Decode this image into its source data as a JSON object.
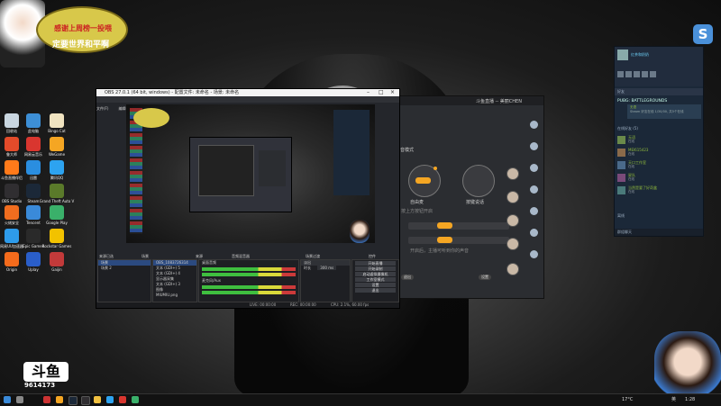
{
  "overlay": {
    "banner_line1": "感谢上周榜一投喂",
    "banner_line2": "定要世界和平啊",
    "room_id": "9614173",
    "platform_logo": "斗鱼",
    "stickers": [
      "开播",
      "直播",
      "主播"
    ]
  },
  "desktop_icons": [
    {
      "label": "回收站",
      "color": "#c9d6e0"
    },
    {
      "label": "此电脑",
      "color": "#3d8fd6"
    },
    {
      "label": "Bingo Cat",
      "color": "#f0e3c0"
    },
    {
      "label": "鲁大师",
      "color": "#e34b2a"
    },
    {
      "label": "网易云音乐",
      "color": "#d9362f"
    },
    {
      "label": "WeGame",
      "color": "#f5a623"
    },
    {
      "label": "斗鱼直播伴侣",
      "color": "#ff7a1a"
    },
    {
      "label": "迅雷",
      "color": "#2a8ee0"
    },
    {
      "label": "腾讯QQ",
      "color": "#2da3f0"
    },
    {
      "label": "OBS Studio",
      "color": "#302e31"
    },
    {
      "label": "Steam",
      "color": "#1b2838"
    },
    {
      "label": "Grand Theft Auto V",
      "color": "#5a7a2a"
    },
    {
      "label": "火绒安全",
      "color": "#f06d1f"
    },
    {
      "label": "Tencent",
      "color": "#3a8ad9"
    },
    {
      "label": "Google Play",
      "color": "#3ab06a"
    },
    {
      "label": "网易UU加速器",
      "color": "#2e9bea"
    },
    {
      "label": "Epic Games",
      "color": "#2a2a2a"
    },
    {
      "label": "Rockstar Games",
      "color": "#f2c200"
    },
    {
      "label": "Origin",
      "color": "#f46b1c"
    },
    {
      "label": "Uplay",
      "color": "#2a5ec9"
    },
    {
      "label": "Gaijin",
      "color": "#c23a3a"
    }
  ],
  "obs": {
    "title": "OBS 27.0.1 (64 bit, windows) - 配置文件: 未命名 - 场景: 未命名",
    "menu": [
      "文件(F)",
      "编辑(E)",
      "视图(V)",
      "停靠窗口(D)",
      "配置文件(P)",
      "场景集合(S)",
      "工具(T)",
      "帮助(H)"
    ],
    "dock_titles": [
      "来源已选",
      "场景",
      "来源",
      "音频混音器",
      "场景过渡",
      "控件"
    ],
    "scenes": [
      "场景",
      "场景 2"
    ],
    "sources": [
      "OBS_1083726314",
      "文本 (GDI+) 5",
      "文本 (GDI+) 4",
      "显示器采集",
      "文本 (GDI+) 3",
      "图像",
      "MIUMIU.png"
    ],
    "audio": [
      "桌面音频",
      "麦克风/Aux"
    ],
    "transition": {
      "type": "淡出",
      "duration_label": "时长",
      "duration": "300 ms"
    },
    "controls": [
      "开始直播",
      "开始录制",
      "启动虚拟摄像机",
      "工作室模式",
      "设置",
      "退出"
    ],
    "status": [
      "LIVE: 00:00:00",
      "REC: 00:00:00",
      "CPU: 2.1%, 60.00 fps"
    ]
  },
  "chat": {
    "title_user": "斗鱼直播 -- 美丽CHEN",
    "mode_label": "语音模式",
    "circle_labels": [
      "自由麦",
      "按键说话"
    ],
    "hints": [
      "按上方按钮开启",
      "自由麦模式",
      "音量",
      "麦克风"
    ],
    "buttons": [
      "设置",
      "退出"
    ],
    "note": "开启后，主播可听到你的声音"
  },
  "steam": {
    "self_name": "红茶和奶奶",
    "search_placeholder": "好友",
    "game_group": "PUBG: BATTLEGROUNDS",
    "game_friend": "无语",
    "game_detail": "Steam 好友在线 1/30/00, 共5个在线",
    "group_online": "在线好友 (5)",
    "friends": [
      {
        "name": "无语",
        "status": "在线",
        "color": "#6a8a4a"
      },
      {
        "name": "MEI615423",
        "status": "在线",
        "color": "#8a6a4a"
      },
      {
        "name": "天口工作室",
        "status": "在线",
        "color": "#4a6a8a"
      },
      {
        "name": "星队",
        "status": "在线",
        "color": "#7a4a7a"
      },
      {
        "name": "当然是要了好奇盒",
        "status": "在线",
        "color": "#4a7a7a"
      }
    ],
    "group_offline": "离线",
    "footer": "群组聊天"
  },
  "taskbar": {
    "time": "1:28",
    "date": "2021/8/24",
    "lang": "英",
    "temp": "17°C"
  }
}
